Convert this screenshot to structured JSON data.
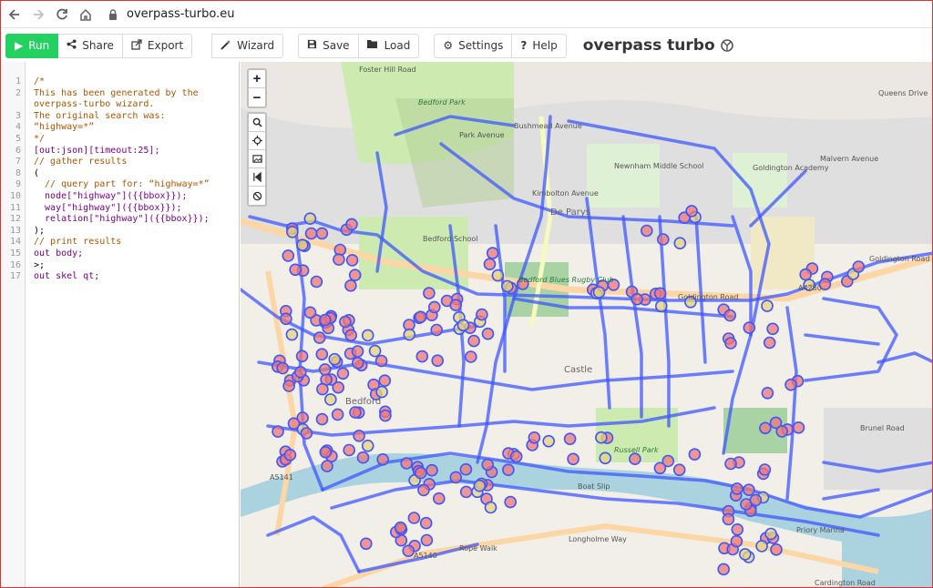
{
  "browser": {
    "url": "overpass-turbo.eu",
    "icons": [
      "back-icon",
      "forward-icon",
      "reload-icon",
      "home-icon",
      "lock-icon"
    ]
  },
  "toolbar": {
    "run": "Run",
    "share": "Share",
    "export": "Export",
    "wizard": "Wizard",
    "save": "Save",
    "load": "Load",
    "settings": "Settings",
    "help": "Help",
    "title": "overpass turbo"
  },
  "editor": {
    "lines": [
      {
        "n": "1",
        "text": "/*",
        "cls": "c-comment"
      },
      {
        "n": "2",
        "text": "This has been generated by the",
        "cls": "c-comment"
      },
      {
        "n": "",
        "text": "overpass-turbo wizard.",
        "cls": "c-comment"
      },
      {
        "n": "3",
        "text": "The original search was:",
        "cls": "c-comment"
      },
      {
        "n": "4",
        "text": "“highway=*”",
        "cls": "c-comment"
      },
      {
        "n": "5",
        "text": "*/",
        "cls": "c-comment"
      },
      {
        "n": "6",
        "text": "[out:json][timeout:25];",
        "cls": "c-kw"
      },
      {
        "n": "7",
        "text": "// gather results",
        "cls": "c-comment"
      },
      {
        "n": "8",
        "text": "(",
        "cls": "c-plain"
      },
      {
        "n": "9",
        "text": "  // query part for: “highway=*”",
        "cls": "c-comment"
      },
      {
        "n": "10",
        "text": "  node[\"highway\"]({{bbox}});",
        "cls": "c-kw"
      },
      {
        "n": "11",
        "text": "  way[\"highway\"]({{bbox}});",
        "cls": "c-kw"
      },
      {
        "n": "12",
        "text": "  relation[\"highway\"]({{bbox}});",
        "cls": "c-kw"
      },
      {
        "n": "13",
        "text": ");",
        "cls": "c-plain"
      },
      {
        "n": "14",
        "text": "// print results",
        "cls": "c-comment"
      },
      {
        "n": "15",
        "text": "out body;",
        "cls": "c-kw"
      },
      {
        "n": "16",
        "text": ">;",
        "cls": "c-plain"
      },
      {
        "n": "17",
        "text": "out skel qt;",
        "cls": "c-kw"
      }
    ]
  },
  "map": {
    "zoom_in": "+",
    "zoom_out": "−",
    "labels": [
      {
        "text": "Foster Hill Road",
        "cls": ""
      },
      {
        "text": "Bedford Park",
        "cls": "green"
      },
      {
        "text": "Park Avenue",
        "cls": ""
      },
      {
        "text": "Newnham Middle School",
        "cls": ""
      },
      {
        "text": "Goldington Academy",
        "cls": ""
      },
      {
        "text": "De Parys",
        "cls": "big"
      },
      {
        "text": "Bedford School",
        "cls": ""
      },
      {
        "text": "Bedford Blues Rugby Club",
        "cls": "green"
      },
      {
        "text": "Goldington Road",
        "cls": ""
      },
      {
        "text": "Castle",
        "cls": "big"
      },
      {
        "text": "Bedford",
        "cls": "big"
      },
      {
        "text": "Russell Park",
        "cls": "green"
      },
      {
        "text": "Boat Slip",
        "cls": ""
      },
      {
        "text": "Longholme Way",
        "cls": ""
      },
      {
        "text": "Rope Walk",
        "cls": ""
      },
      {
        "text": "Cardington Road",
        "cls": ""
      },
      {
        "text": "Priory Marina",
        "cls": ""
      },
      {
        "text": "Brunel Road",
        "cls": ""
      },
      {
        "text": "A5141",
        "cls": ""
      },
      {
        "text": "A5140",
        "cls": ""
      },
      {
        "text": "A4280",
        "cls": ""
      },
      {
        "text": "Queens Drive",
        "cls": ""
      },
      {
        "text": "Goldington Road",
        "cls": ""
      },
      {
        "text": "Kimbolton Avenue",
        "cls": ""
      },
      {
        "text": "Bushmead Avenue",
        "cls": ""
      },
      {
        "text": "Malvern Avenue",
        "cls": ""
      }
    ]
  }
}
